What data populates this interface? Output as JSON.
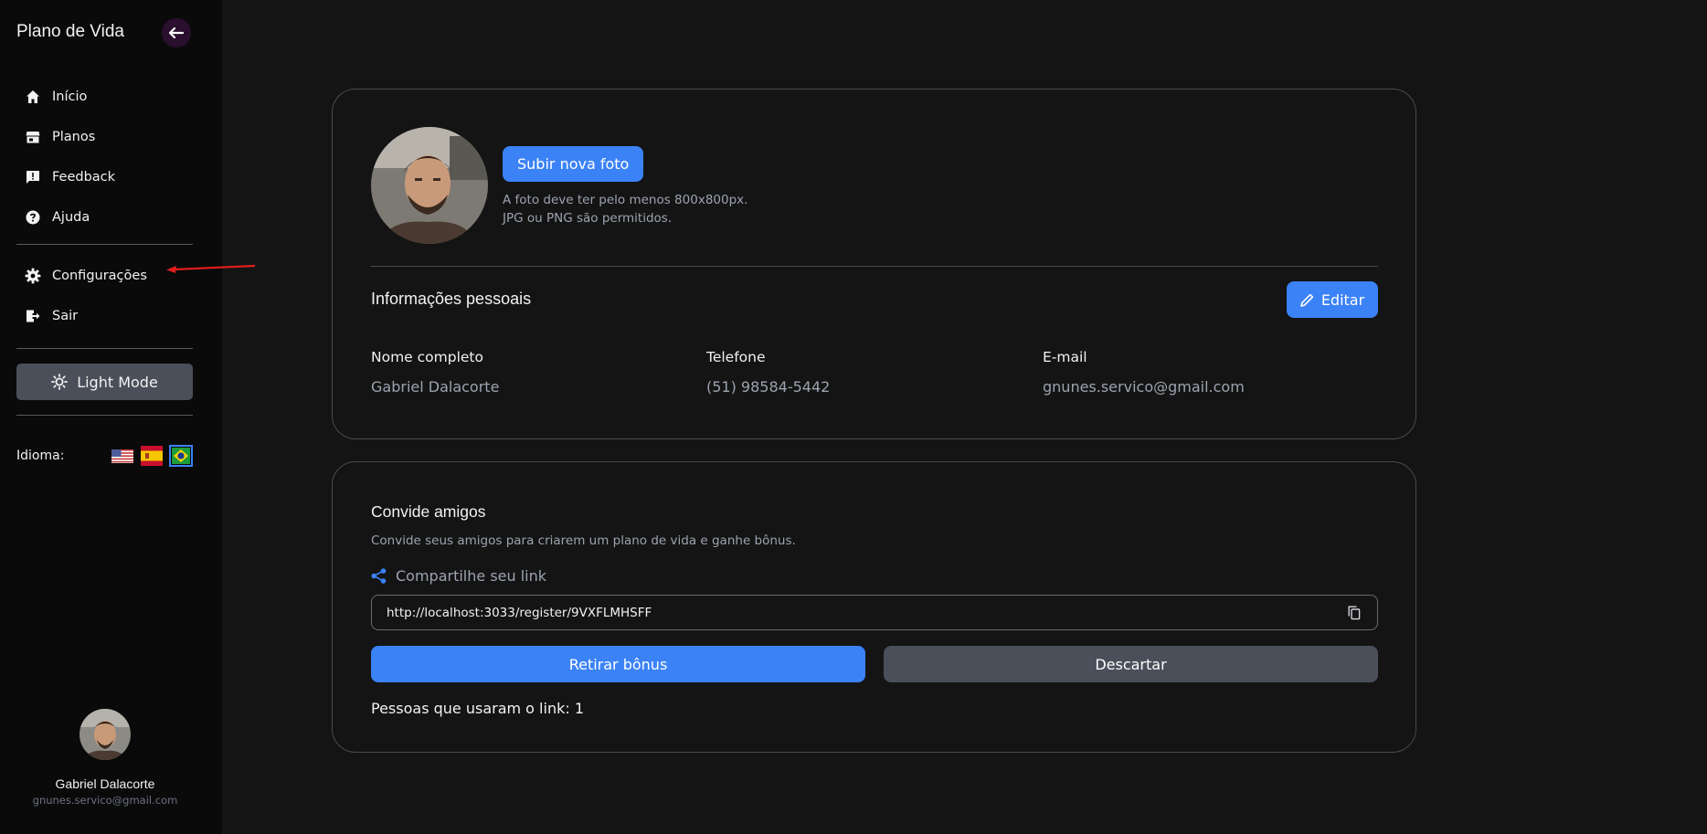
{
  "sidebar": {
    "app_title": "Plano de Vida",
    "items": [
      {
        "label": "Início",
        "icon": "home-icon"
      },
      {
        "label": "Planos",
        "icon": "store-icon"
      },
      {
        "label": "Feedback",
        "icon": "feedback-icon"
      },
      {
        "label": "Ajuda",
        "icon": "help-icon"
      }
    ],
    "settings_items": [
      {
        "label": "Configurações",
        "icon": "gear-icon"
      },
      {
        "label": "Sair",
        "icon": "logout-icon"
      }
    ],
    "light_mode_label": "Light Mode",
    "language_label": "Idioma:",
    "languages": [
      "en-us-flag",
      "es-flag",
      "pt-br-flag"
    ],
    "user": {
      "name": "Gabriel Dalacorte",
      "email": "gnunes.servico@gmail.com"
    }
  },
  "profile": {
    "upload_button": "Subir nova foto",
    "hint_line1": "A foto deve ter pelo menos 800x800px.",
    "hint_line2": "JPG ou PNG são permitidos.",
    "section_title": "Informações pessoais",
    "edit_button": "Editar",
    "fields": [
      {
        "label": "Nome completo",
        "value": "Gabriel Dalacorte"
      },
      {
        "label": "Telefone",
        "value": "(51) 98584-5442"
      },
      {
        "label": "E-mail",
        "value": "gnunes.servico@gmail.com"
      }
    ]
  },
  "invite": {
    "title": "Convide amigos",
    "description": "Convide seus amigos para criarem um plano de vida e ganhe bônus.",
    "share_label": "Compartilhe seu link",
    "link": "http://localhost:3033/register/9VXFLMHSFF",
    "withdraw_button": "Retirar bônus",
    "discard_button": "Descartar",
    "people_used": "Pessoas que usaram o link: 1"
  },
  "colors": {
    "accent": "#3b82f6",
    "secondary_button": "#4a4f5a",
    "background": "#141414",
    "sidebar": "#0a0a0a",
    "annotation": "#e11d1d"
  }
}
